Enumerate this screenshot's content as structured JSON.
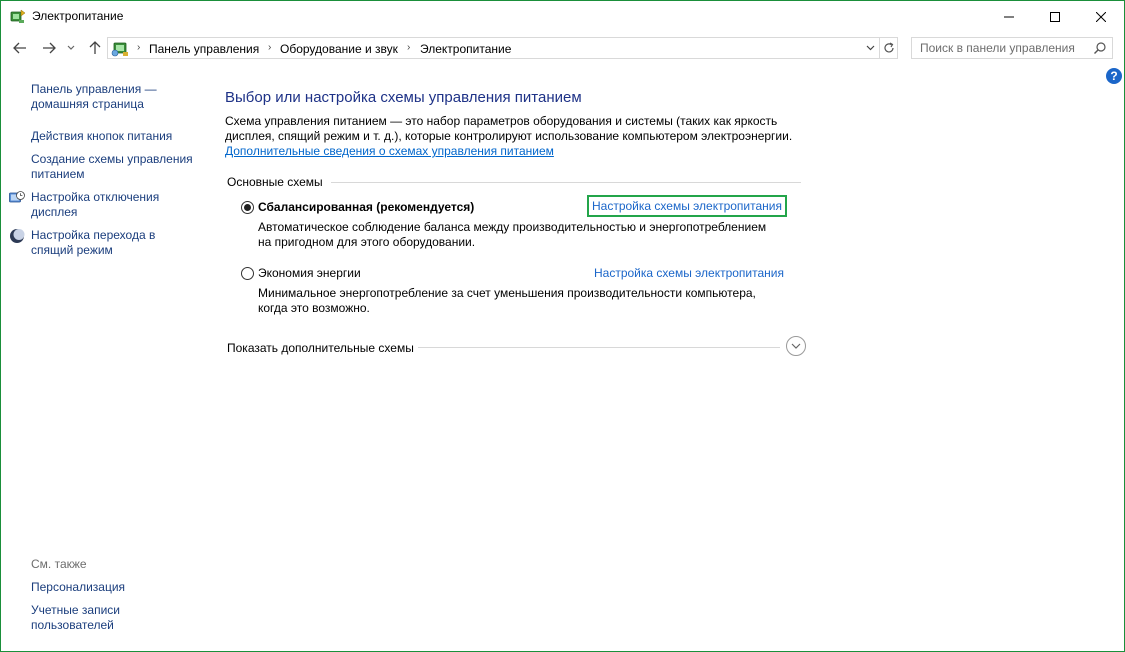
{
  "window": {
    "title": "Электропитание",
    "minimize_symbol": "—",
    "close_symbol": "✕"
  },
  "nav": {
    "breadcrumb": [
      "Панель управления",
      "Оборудование и звук",
      "Электропитание"
    ],
    "search_placeholder": "Поиск в панели управления"
  },
  "help": {
    "label": "?"
  },
  "sidebar": {
    "items": [
      {
        "line1": "Панель управления —",
        "line2": "домашняя страница"
      },
      {
        "line1": "Действия кнопок питания",
        "line2": ""
      },
      {
        "line1": "Создание схемы управления",
        "line2": "питанием"
      },
      {
        "line1": "Настройка отключения",
        "line2": "дисплея"
      },
      {
        "line1": "Настройка перехода в",
        "line2": "спящий режим"
      }
    ],
    "see_also_label": "См. также",
    "see_also_items": [
      {
        "line1": "Персонализация",
        "line2": ""
      },
      {
        "line1": "Учетные записи",
        "line2": "пользователей"
      }
    ]
  },
  "main": {
    "title": "Выбор или настройка схемы управления питанием",
    "desc_line1": "Схема управления питанием — это набор параметров оборудования и системы (таких как яркость",
    "desc_line2": "дисплея, спящий режим и т. д.), которые контролируют использование компьютером электроэнергии.",
    "more_info_link": "Дополнительные сведения о схемах управления питанием",
    "group_label": "Основные схемы",
    "plans": [
      {
        "name": "Сбалансированная (рекомендуется)",
        "selected": true,
        "desc_line1": "Автоматическое соблюдение баланса между производительностью и энергопотреблением",
        "desc_line2": "на пригодном для этого оборудовании.",
        "link": "Настройка схемы электропитания"
      },
      {
        "name": "Экономия энергии",
        "selected": false,
        "desc_line1": "Минимальное энергопотребление за счет уменьшения производительности компьютера,",
        "desc_line2": "когда это возможно.",
        "link": "Настройка схемы электропитания"
      }
    ],
    "show_more_label": "Показать дополнительные схемы"
  },
  "colors": {
    "title_blue": "#1e3287",
    "link_blue": "#1b66c9",
    "highlight_green": "#23a54a"
  }
}
